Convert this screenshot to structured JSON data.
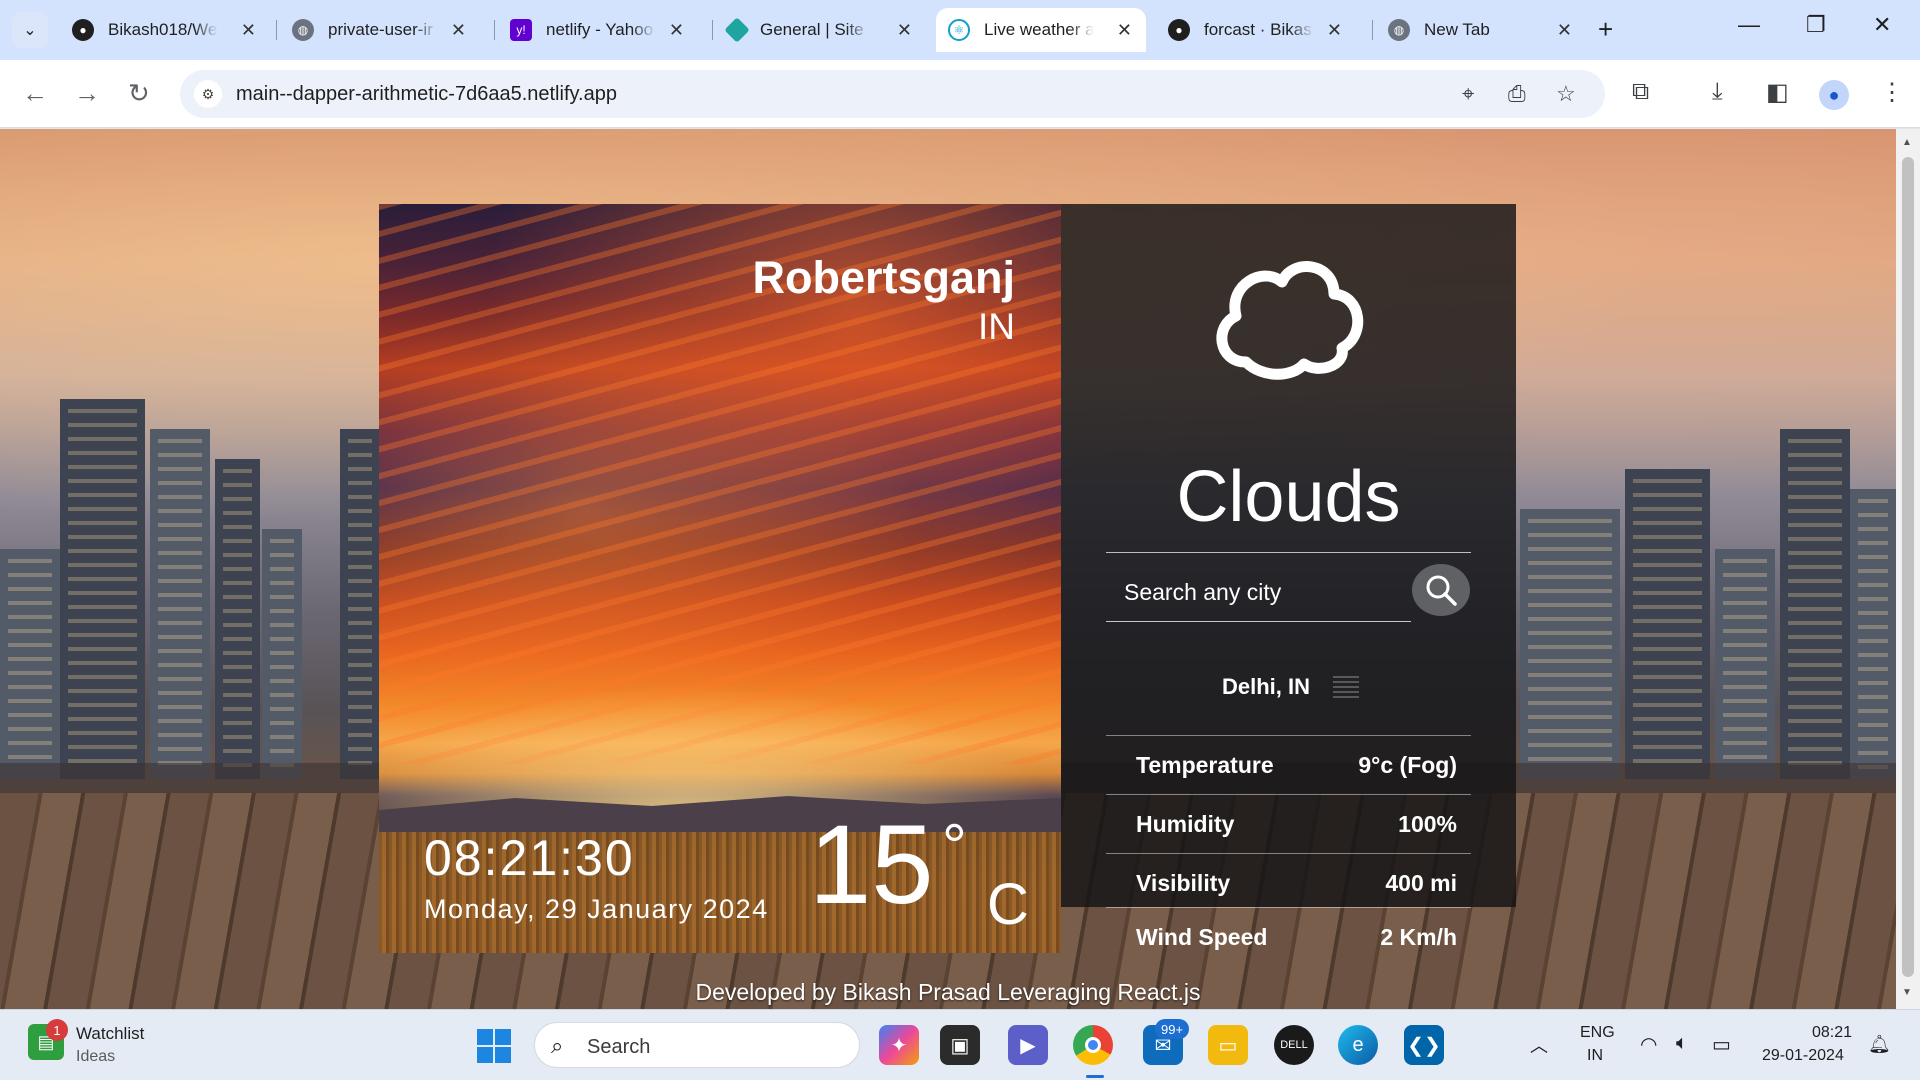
{
  "browser": {
    "tabs": [
      {
        "title": "Bikash018/We",
        "icon": "github-icon",
        "icon_color": "#1f1f1f"
      },
      {
        "title": "private-user-ir",
        "icon": "globe-icon",
        "icon_color": "#6b7280"
      },
      {
        "title": "netlify - Yahoo",
        "icon": "yahoo-icon",
        "icon_color": "#6001d2"
      },
      {
        "title": "General | Site c",
        "icon": "netlify-icon",
        "icon_color": "#1ea59f"
      },
      {
        "title": "Live weather a",
        "icon": "react-icon",
        "icon_color": "#149eca"
      },
      {
        "title": "forcast · Bikas",
        "icon": "github-icon",
        "icon_color": "#1f1f1f"
      },
      {
        "title": "New Tab",
        "icon": "globe-icon",
        "icon_color": "#6b7280"
      }
    ],
    "active_tab_index": 4,
    "url": "main--dapper-arithmetic-7d6aa5.netlify.app"
  },
  "weather": {
    "location": {
      "city": "Robertsganj",
      "country": "IN"
    },
    "time": "08:21:30",
    "date": "Monday, 29 January 2024",
    "temperature": {
      "value": "15",
      "degree": "°",
      "unit": "C"
    },
    "condition": "Clouds",
    "search": {
      "placeholder": "Search any city"
    },
    "result": {
      "city": "Delhi, IN",
      "stats": [
        {
          "label": "Temperature",
          "value": "9°c (Fog)"
        },
        {
          "label": "Humidity",
          "value": "100%"
        },
        {
          "label": "Visibility",
          "value": "400 mi"
        },
        {
          "label": "Wind Speed",
          "value": "2 Km/h"
        }
      ]
    },
    "footer": "Developed by Bikash Prasad Leveraging React.js"
  },
  "taskbar": {
    "widget": {
      "title": "Watchlist",
      "subtitle": "Ideas",
      "badge": "1"
    },
    "search_label": "Search",
    "mail_badge": "99+",
    "tray": {
      "lang_line1": "ENG",
      "lang_line2": "IN"
    },
    "clock": {
      "time": "08:21",
      "date": "29-01-2024"
    }
  }
}
